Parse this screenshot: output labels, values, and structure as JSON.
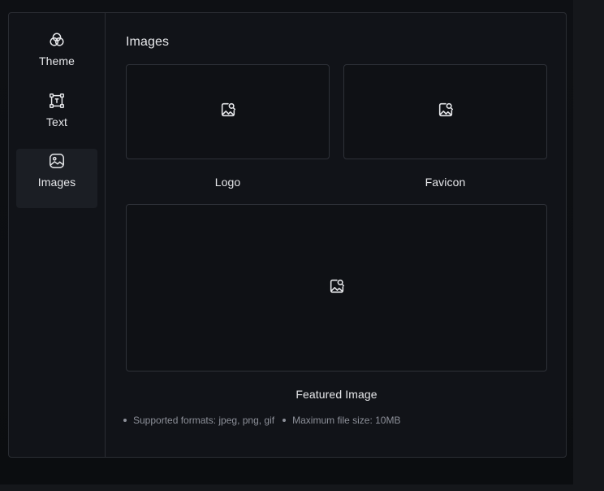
{
  "sidebar": {
    "items": [
      {
        "label": "Theme",
        "icon": "theme-circles-icon",
        "active": false
      },
      {
        "label": "Text",
        "icon": "text-frame-icon",
        "active": false
      },
      {
        "label": "Images",
        "icon": "image-icon",
        "active": true
      }
    ]
  },
  "main": {
    "title": "Images",
    "uploads": [
      {
        "label": "Logo",
        "icon": "image-search-icon"
      },
      {
        "label": "Favicon",
        "icon": "image-search-icon"
      },
      {
        "label": "Featured Image",
        "icon": "image-search-icon"
      }
    ],
    "notes": [
      "Supported formats: jpeg, png, gif",
      "Maximum file size: 10MB"
    ]
  },
  "colors": {
    "background": "#0d0f12",
    "panel": "#111318",
    "border": "#2a2d33",
    "active_item": "#1b1e24",
    "text": "#e6e7ea",
    "muted_text": "#8d9099"
  }
}
